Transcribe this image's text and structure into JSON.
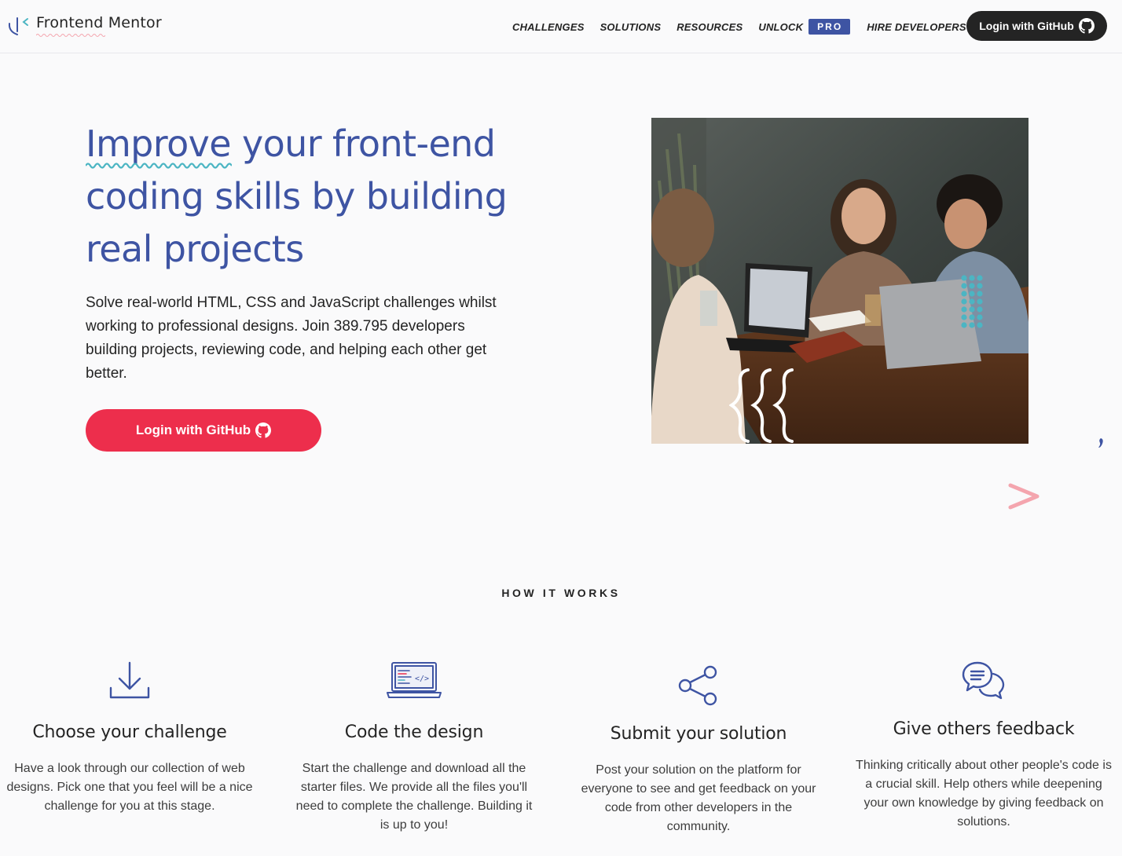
{
  "nav": {
    "brand": "Frontend Mentor",
    "links": [
      "CHALLENGES",
      "SOLUTIONS",
      "RESOURCES",
      "UNLOCK"
    ],
    "pro_badge": "PRO",
    "hire": "HIRE DEVELOPERS",
    "login": "Login with GitHub"
  },
  "hero": {
    "title_word1": "Improve",
    "title_rest": " your front-end coding skills by building real projects",
    "description": "Solve real-world HTML, CSS and JavaScript challenges whilst working to professional designs. Join 389.795 developers building projects, reviewing code, and helping each other get better.",
    "cta": "Login with GitHub"
  },
  "how": {
    "label": "HOW IT WORKS",
    "steps": [
      {
        "title": "Choose your challenge",
        "desc": "Have a look through our collection of web designs. Pick one that you feel will be a nice challenge for you at this stage.",
        "icon": "download-icon"
      },
      {
        "title": "Code the design",
        "desc": "Start the challenge and download all the starter files. We provide all the files you'll need to complete the challenge. Building it is up to you!",
        "icon": "laptop-code-icon"
      },
      {
        "title": "Submit your solution",
        "desc": "Post your solution on the platform for everyone to see and get feedback on your code from other developers in the community.",
        "icon": "share-icon"
      },
      {
        "title": "Give others feedback",
        "desc": "Thinking critically about other people's code is a crucial skill. Help others while deepening your own knowledge by giving feedback on solutions.",
        "icon": "chat-bubbles-icon"
      }
    ]
  },
  "colors": {
    "brand_blue": "#3e54a3",
    "cta_red": "#ed2e4c",
    "teal": "#4cb5c3",
    "pink": "#f4a5ae",
    "dark": "#242424"
  }
}
